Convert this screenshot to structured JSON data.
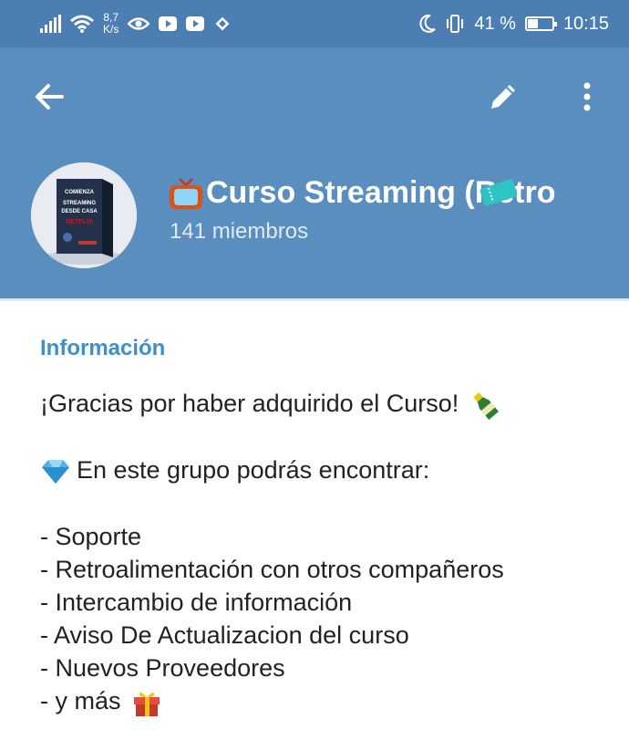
{
  "status_bar": {
    "speed_value": "8,7",
    "speed_unit": "K/s",
    "battery": "41 %",
    "battery_level": 0.41,
    "time": "10:15"
  },
  "header": {
    "title": "Curso Streaming (Retro",
    "members": "141 miembros",
    "icons": [
      "back-arrow-icon",
      "pencil-icon",
      "more-vertical-icon"
    ],
    "background_color": "#5a8ebf"
  },
  "avatar": {
    "cover_lines": [
      "COMIENZA",
      "STREAMING",
      "DESDE CASA",
      "NETFLIX"
    ]
  },
  "info": {
    "label": "Información",
    "lines": [
      "¡Gracias por haber adquirido el Curso!",
      "En este grupo podrás encontrar:",
      "- Soporte",
      "- Retroalimentación con otros compañeros",
      "- Intercambio de información",
      "- Aviso De Actualizacion del curso",
      "- Nuevos Proveedores",
      "- y más"
    ],
    "accent_color": "#3f8fc9"
  }
}
